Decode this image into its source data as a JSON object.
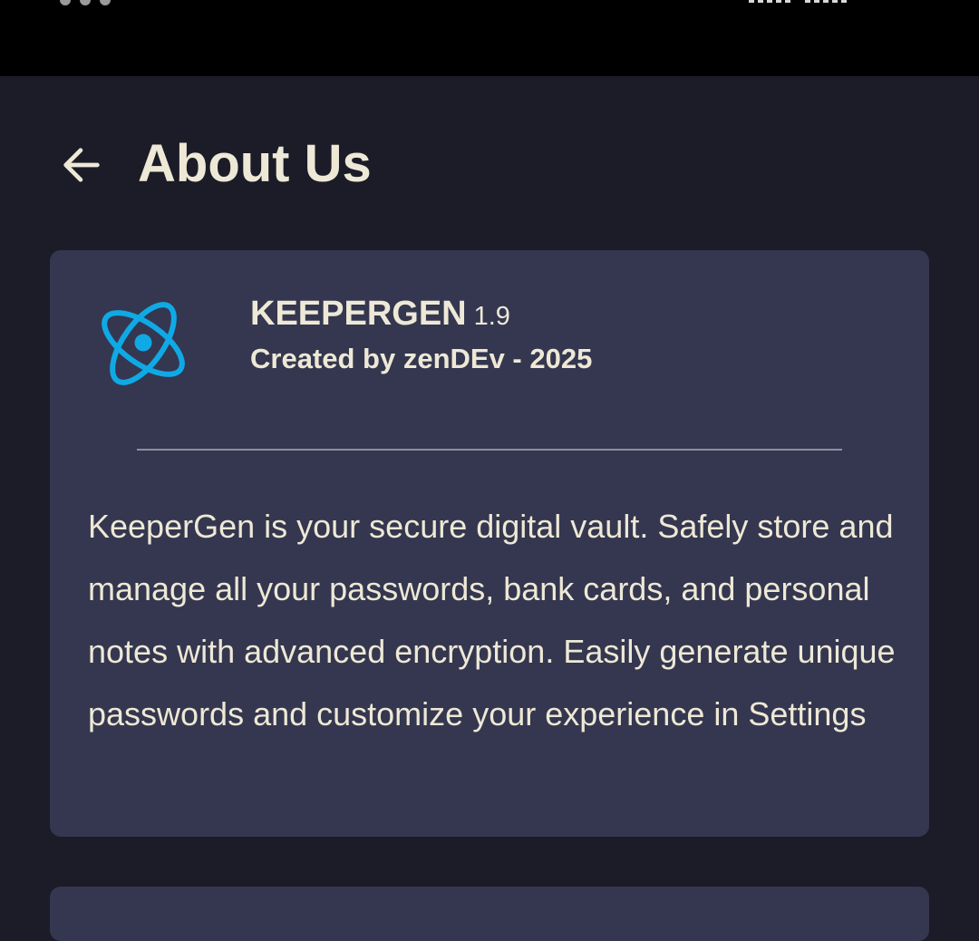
{
  "colors": {
    "background": "#1b1c28",
    "status_bar": "#000000",
    "card": "#34374f",
    "text": "#eee8d6",
    "accent": "#0fa9e6",
    "divider": "#8e90a2"
  },
  "header": {
    "back_icon": "arrow-left-icon",
    "title": "About Us"
  },
  "about_card": {
    "logo_icon": "atom-logo-icon",
    "app_name": "KEEPERGEN",
    "version": "1.9",
    "created_by": "Created by zenDEv - 2025",
    "description": "KeeperGen is your secure digital vault. Safely store and manage all your passwords, bank cards, and personal notes with advanced encryption. Easily generate unique passwords and customize your experience in Settings"
  }
}
